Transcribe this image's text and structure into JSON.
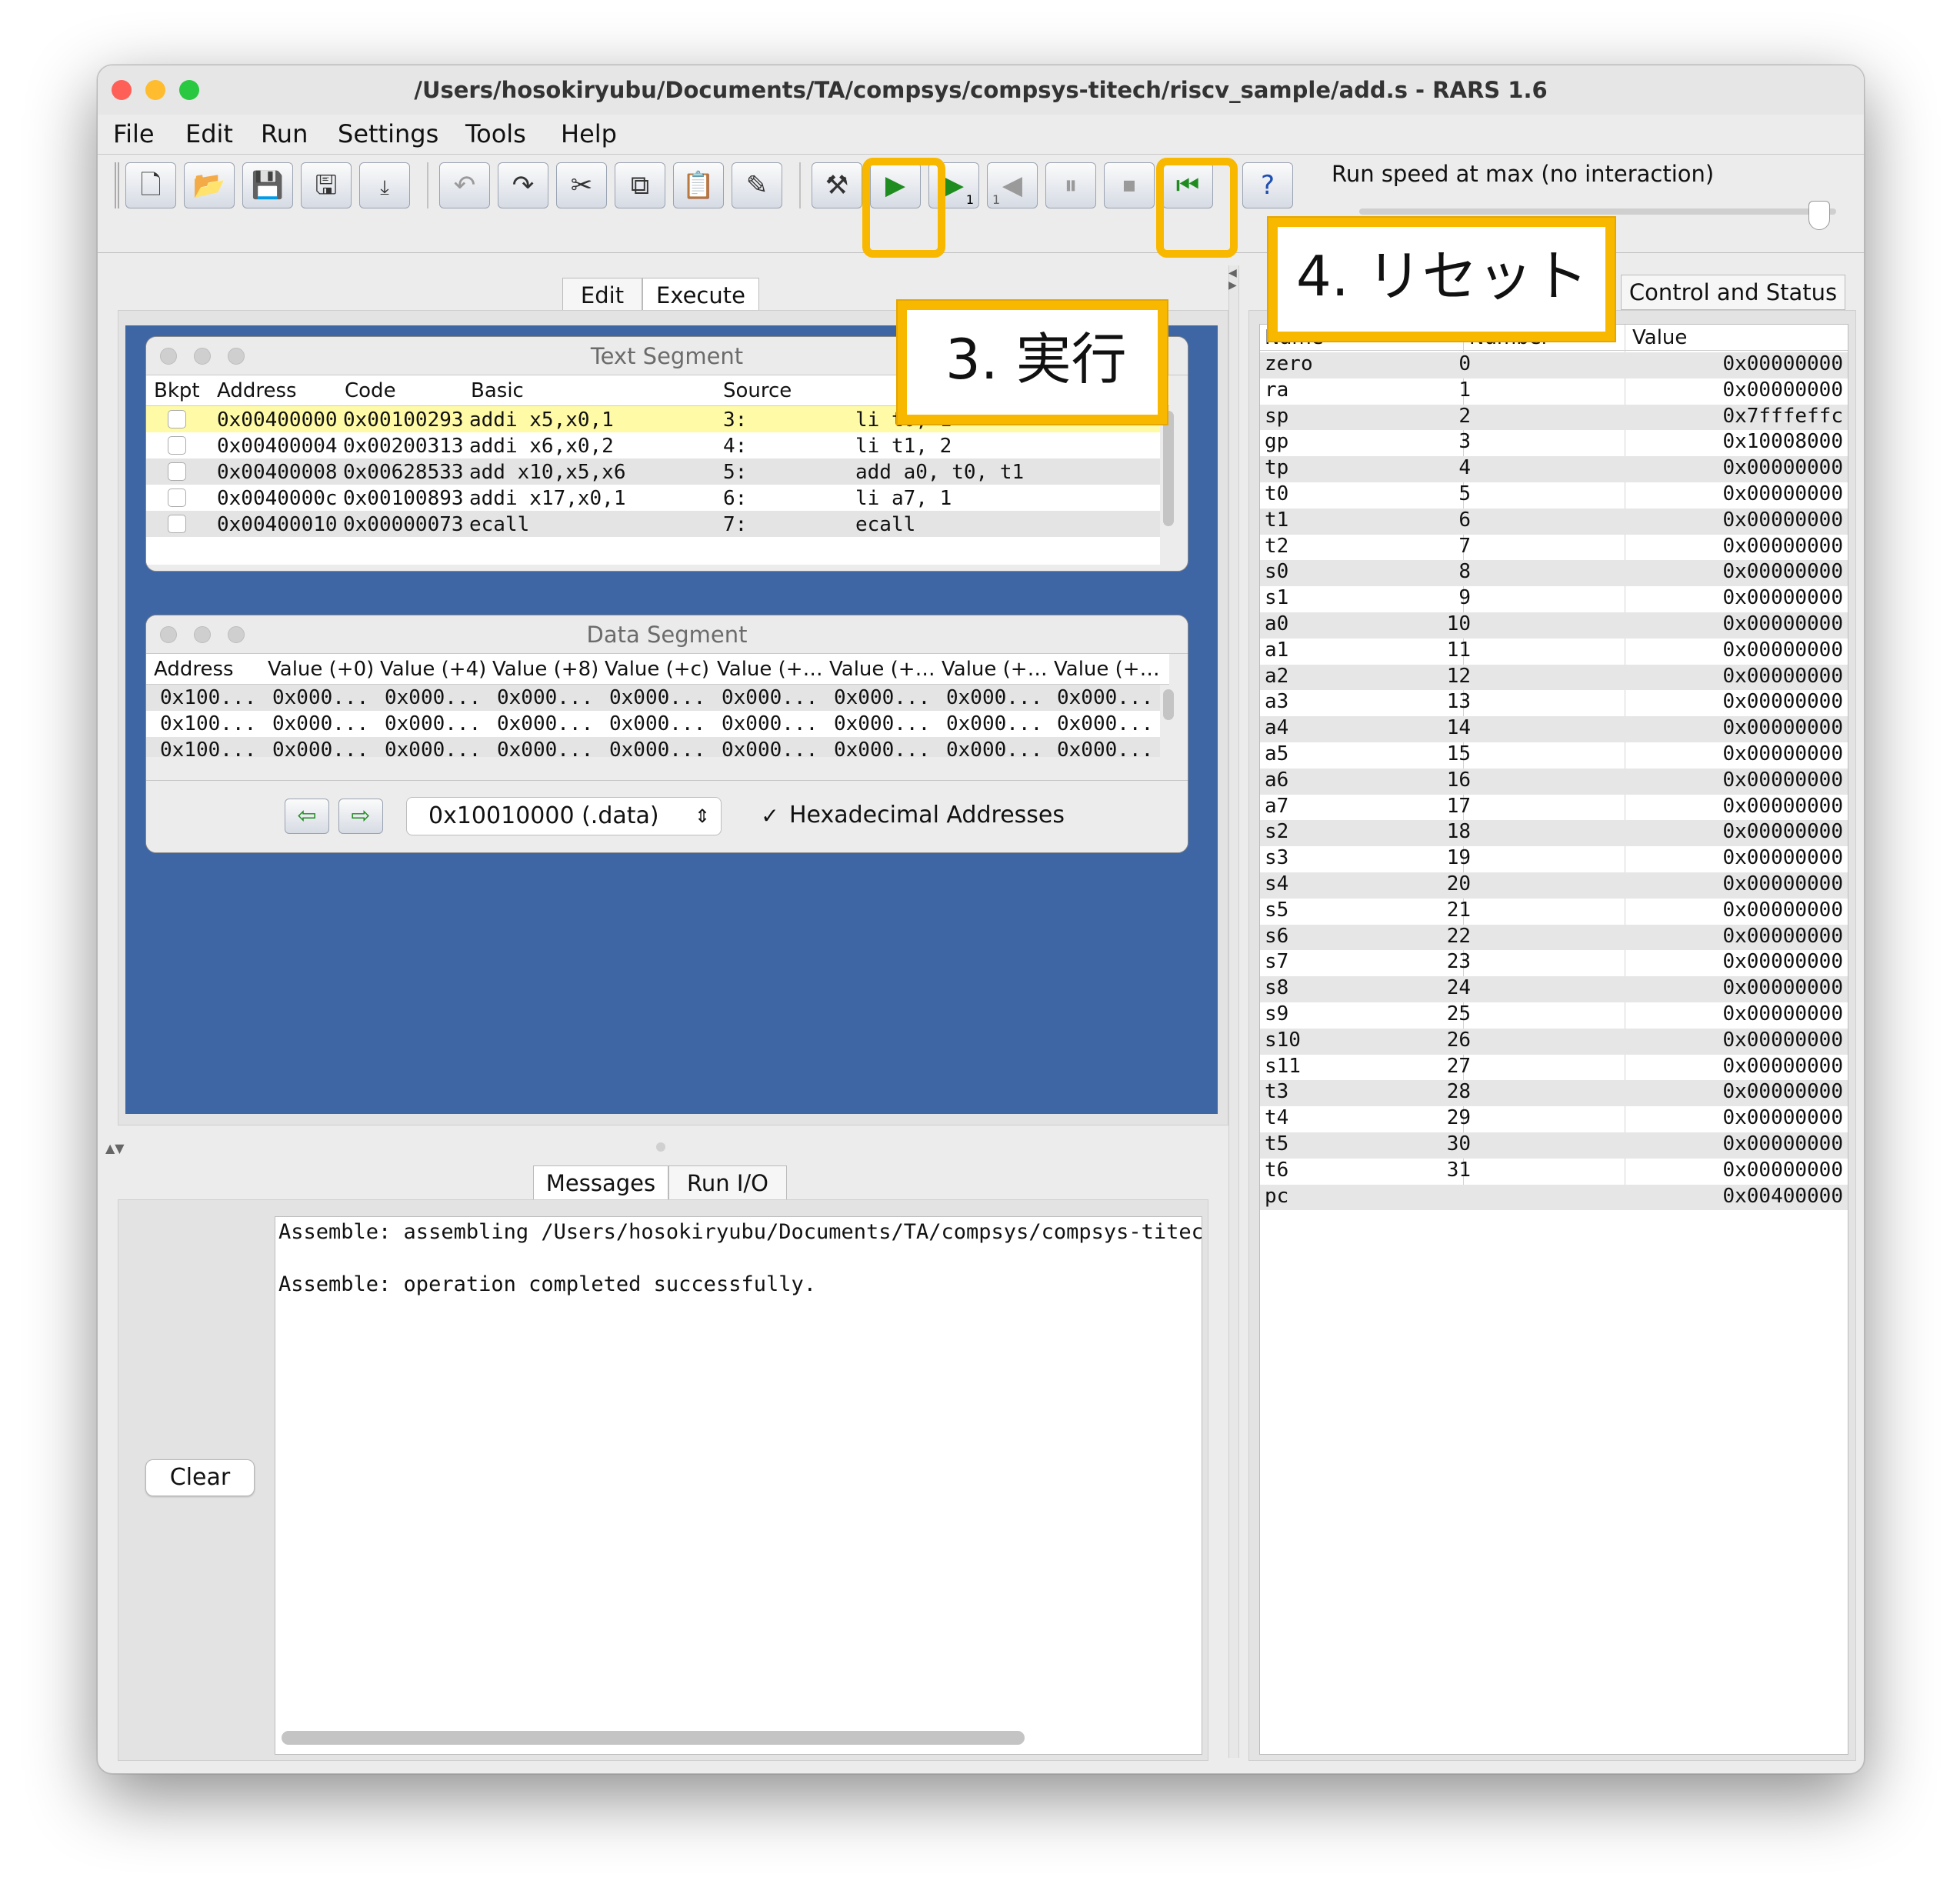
{
  "window": {
    "title": "/Users/hosokiryubu/Documents/TA/compsys/compsys-titech/riscv_sample/add.s  - RARS 1.6"
  },
  "menu": [
    "File",
    "Edit",
    "Run",
    "Settings",
    "Tools",
    "Help"
  ],
  "toolbar": {
    "step_badge": "1",
    "backstep_badge": "1",
    "run_speed_label": "Run speed at max (no interaction)"
  },
  "main_tabs": [
    "Edit",
    "Execute"
  ],
  "text_segment": {
    "title": "Text Segment",
    "columns": [
      "Bkpt",
      "Address",
      "Code",
      "Basic",
      "Source"
    ],
    "rows": [
      {
        "address": "0x00400000",
        "code": "0x00100293",
        "basic": "addi x5,x0,1",
        "line": "3:",
        "source": "li t0, 1"
      },
      {
        "address": "0x00400004",
        "code": "0x00200313",
        "basic": "addi x6,x0,2",
        "line": "4:",
        "source": "li t1, 2"
      },
      {
        "address": "0x00400008",
        "code": "0x00628533",
        "basic": "add x10,x5,x6",
        "line": "5:",
        "source": "add a0, t0, t1"
      },
      {
        "address": "0x0040000c",
        "code": "0x00100893",
        "basic": "addi x17,x0,1",
        "line": "6:",
        "source": "li a7, 1"
      },
      {
        "address": "0x00400010",
        "code": "0x00000073",
        "basic": "ecall",
        "line": "7:",
        "source": "ecall"
      }
    ]
  },
  "data_segment": {
    "title": "Data Segment",
    "columns": [
      "Address",
      "Value (+0)",
      "Value (+4)",
      "Value (+8)",
      "Value (+c)",
      "Value (+…",
      "Value (+…",
      "Value (+…",
      "Value (+…"
    ],
    "rows": [
      [
        "0x100...",
        "0x000...",
        "0x000...",
        "0x000...",
        "0x000...",
        "0x000...",
        "0x000...",
        "0x000...",
        "0x000..."
      ],
      [
        "0x100...",
        "0x000...",
        "0x000...",
        "0x000...",
        "0x000...",
        "0x000...",
        "0x000...",
        "0x000...",
        "0x000..."
      ],
      [
        "0x100...",
        "0x000...",
        "0x000...",
        "0x000...",
        "0x000...",
        "0x000...",
        "0x000...",
        "0x000...",
        "0x000..."
      ]
    ],
    "segment_select": "0x10010000 (.data)",
    "hex_addresses_label": "Hexadecimal Addresses",
    "hex_addresses_checked": true,
    "check_mark": "✓"
  },
  "bottom_tabs": [
    "Messages",
    "Run I/O"
  ],
  "messages": {
    "lines": [
      "Assemble: assembling /Users/hosokiryubu/Documents/TA/compsys/compsys-titech/",
      "",
      "Assemble: operation completed successfully."
    ],
    "clear_label": "Clear"
  },
  "registers": {
    "tab_control_status": "Control and Status",
    "columns": [
      "Name",
      "Number",
      "Value"
    ],
    "rows": [
      [
        "zero",
        "0",
        "0x00000000"
      ],
      [
        "ra",
        "1",
        "0x00000000"
      ],
      [
        "sp",
        "2",
        "0x7fffeffc"
      ],
      [
        "gp",
        "3",
        "0x10008000"
      ],
      [
        "tp",
        "4",
        "0x00000000"
      ],
      [
        "t0",
        "5",
        "0x00000000"
      ],
      [
        "t1",
        "6",
        "0x00000000"
      ],
      [
        "t2",
        "7",
        "0x00000000"
      ],
      [
        "s0",
        "8",
        "0x00000000"
      ],
      [
        "s1",
        "9",
        "0x00000000"
      ],
      [
        "a0",
        "10",
        "0x00000000"
      ],
      [
        "a1",
        "11",
        "0x00000000"
      ],
      [
        "a2",
        "12",
        "0x00000000"
      ],
      [
        "a3",
        "13",
        "0x00000000"
      ],
      [
        "a4",
        "14",
        "0x00000000"
      ],
      [
        "a5",
        "15",
        "0x00000000"
      ],
      [
        "a6",
        "16",
        "0x00000000"
      ],
      [
        "a7",
        "17",
        "0x00000000"
      ],
      [
        "s2",
        "18",
        "0x00000000"
      ],
      [
        "s3",
        "19",
        "0x00000000"
      ],
      [
        "s4",
        "20",
        "0x00000000"
      ],
      [
        "s5",
        "21",
        "0x00000000"
      ],
      [
        "s6",
        "22",
        "0x00000000"
      ],
      [
        "s7",
        "23",
        "0x00000000"
      ],
      [
        "s8",
        "24",
        "0x00000000"
      ],
      [
        "s9",
        "25",
        "0x00000000"
      ],
      [
        "s10",
        "26",
        "0x00000000"
      ],
      [
        "s11",
        "27",
        "0x00000000"
      ],
      [
        "t3",
        "28",
        "0x00000000"
      ],
      [
        "t4",
        "29",
        "0x00000000"
      ],
      [
        "t5",
        "30",
        "0x00000000"
      ],
      [
        "t6",
        "31",
        "0x00000000"
      ],
      [
        "pc",
        "",
        "0x00400000"
      ]
    ]
  },
  "annotations": {
    "run_label": "3. 実行",
    "reset_label": "4. リセット",
    "highlight_color": "#f9b800"
  }
}
